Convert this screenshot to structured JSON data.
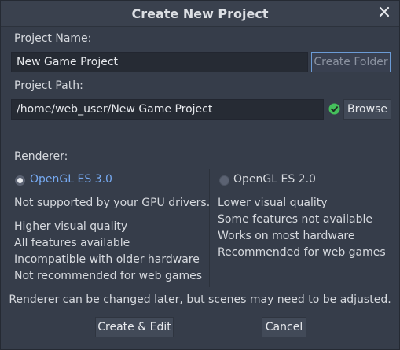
{
  "dialog": {
    "title": "Create New Project",
    "close_icon": "close-icon"
  },
  "project_name": {
    "label": "Project Name:",
    "value": "New Game Project",
    "create_folder_label": "Create Folder"
  },
  "project_path": {
    "label": "Project Path:",
    "value": "/home/web_user/New Game Project",
    "status_icon": "check-circle-icon",
    "browse_label": "Browse"
  },
  "renderer": {
    "label": "Renderer:",
    "options": [
      {
        "name": "OpenGL ES 3.0",
        "selected": true,
        "warning": "Not supported by your GPU drivers.",
        "features": [
          "Higher visual quality",
          "All features available",
          "Incompatible with older hardware",
          "Not recommended for web games"
        ]
      },
      {
        "name": "OpenGL ES 2.0",
        "selected": false,
        "features": [
          "Lower visual quality",
          "Some features not available",
          "Works on most hardware",
          "Recommended for web games"
        ]
      }
    ],
    "note": "Renderer can be changed later, but scenes may need to be adjusted."
  },
  "actions": {
    "create_edit_label": "Create & Edit",
    "cancel_label": "Cancel"
  },
  "colors": {
    "background": "#363d4a",
    "accent": "#76a9f0",
    "success": "#45c05c"
  }
}
